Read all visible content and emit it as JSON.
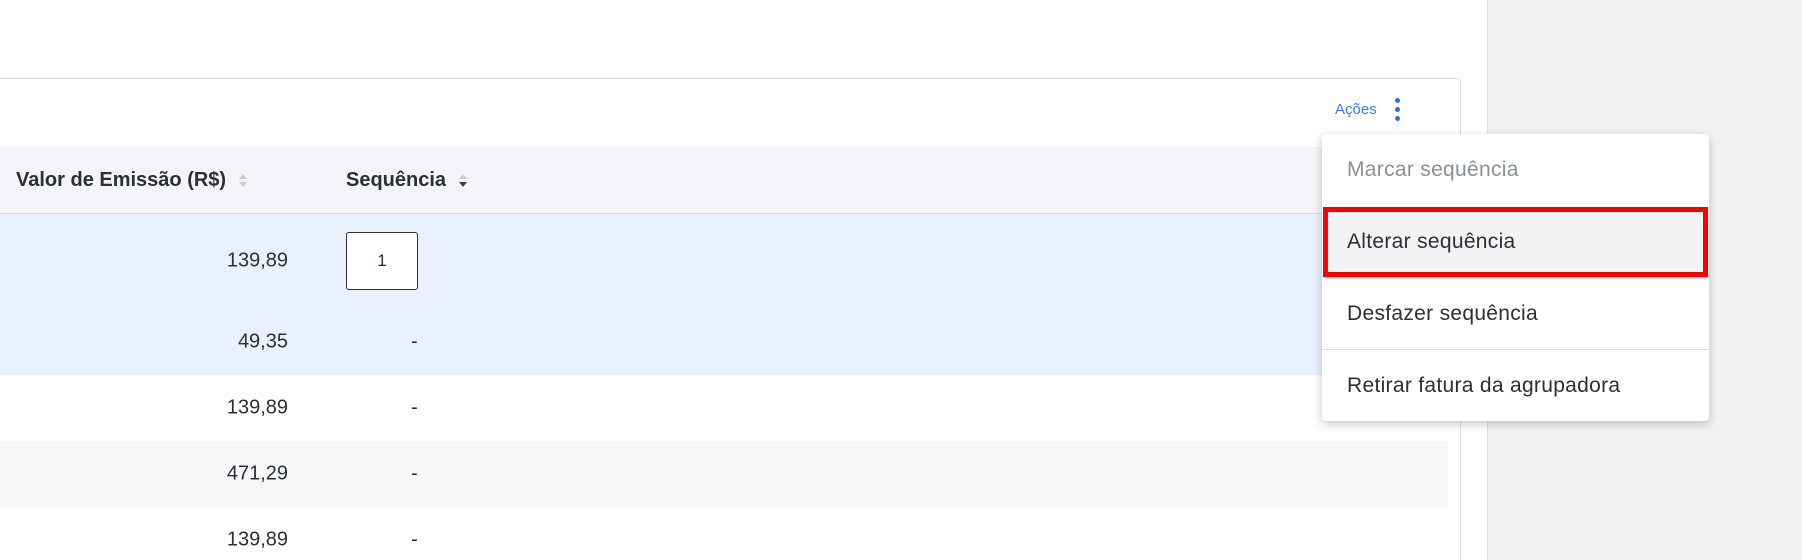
{
  "toolbar": {
    "actions_label": "Ações",
    "menu_icon": "kebab-vertical-icon"
  },
  "table": {
    "columns": [
      {
        "label": "Valor de Emissão (R$)",
        "sort": "none"
      },
      {
        "label": "Sequência",
        "sort": "descending"
      }
    ],
    "rows": [
      {
        "valor": "139,89",
        "sequencia": "1",
        "selected": true
      },
      {
        "valor": "49,35",
        "sequencia": "-",
        "selected": true
      },
      {
        "valor": "139,89",
        "sequencia": "-",
        "selected": false
      },
      {
        "valor": "471,29",
        "sequencia": "-",
        "selected": false
      },
      {
        "valor": "139,89",
        "sequencia": "-",
        "selected": false
      }
    ]
  },
  "menu": {
    "items": [
      {
        "label": "Marcar sequência",
        "disabled": true
      },
      {
        "label": "Alterar sequência",
        "highlighted": true
      },
      {
        "label": "Desfazer sequência"
      },
      {
        "label": "Retirar fatura da agrupadora"
      }
    ]
  },
  "colors": {
    "accent": "#3b7be8",
    "selected_row": "#eaf1fd",
    "highlight_outline": "#ff0000"
  }
}
